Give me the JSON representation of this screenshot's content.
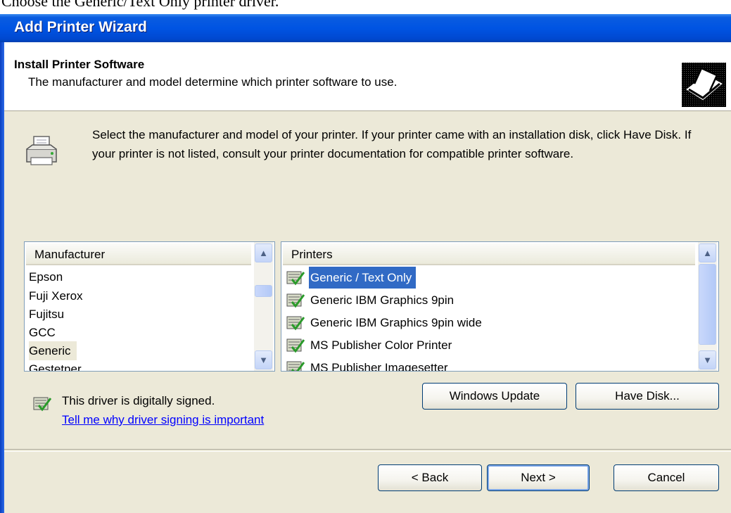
{
  "caption": "Choose the Generic/Text Only printer driver.",
  "window": {
    "title": "Add Printer Wizard"
  },
  "header": {
    "title": "Install Printer Software",
    "subtitle": "The manufacturer and model determine which printer software to use."
  },
  "instructions": "Select the manufacturer and model of your printer. If your printer came with an installation disk, click Have Disk. If your printer is not listed, consult your printer documentation for compatible printer software.",
  "manufacturers": {
    "header": "Manufacturer",
    "items": [
      "Epson",
      "Fuji Xerox",
      "Fujitsu",
      "GCC",
      "Generic",
      "Gestetner"
    ],
    "selected": "Generic"
  },
  "printers": {
    "header": "Printers",
    "items": [
      "Generic / Text Only",
      "Generic IBM Graphics 9pin",
      "Generic IBM Graphics 9pin wide",
      "MS Publisher Color Printer",
      "MS Publisher Imagesetter"
    ],
    "selected": "Generic / Text Only"
  },
  "signing": {
    "status": "This driver is digitally signed.",
    "link": "Tell me why driver signing is important"
  },
  "buttons": {
    "windows_update": "Windows Update",
    "have_disk": "Have Disk...",
    "back": "< Back",
    "next": "Next >",
    "cancel": "Cancel"
  },
  "colors": {
    "titlebar": "#0054e3",
    "dialog_bg": "#ece9d8",
    "selection": "#316ac5",
    "link": "#0000ff"
  },
  "icons": {
    "header": "printer-wizard-icon",
    "instructions": "printer-icon",
    "driver": "signed-driver-icon",
    "scroll_up": "chevron-up-icon",
    "scroll_down": "chevron-down-icon"
  }
}
